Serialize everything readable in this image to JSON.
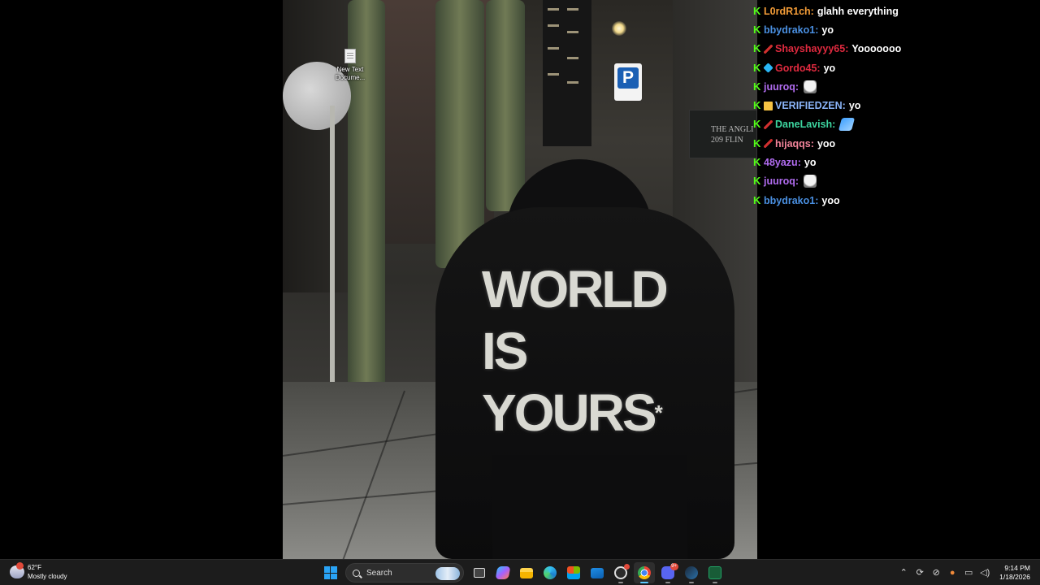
{
  "desktop": {
    "icon_label": "New Text Docume..."
  },
  "wallpaper": {
    "hoodie_line1": "WORLD",
    "hoodie_line2": "IS",
    "hoodie_line3": "YOURS",
    "hoodie_mark": "*",
    "parking_sign": "P",
    "plaque_text": "THE ANGLI\n209 FLIN"
  },
  "chat": {
    "messages": [
      {
        "user": "L0rdR1ch",
        "user_color": "#f39c37",
        "extra_badge": "",
        "text": "glahh everything",
        "emote": ""
      },
      {
        "user": "bbydrako1",
        "user_color": "#4a90e2",
        "extra_badge": "",
        "text": "yo",
        "emote": ""
      },
      {
        "user": "Shayshayyy65",
        "user_color": "#e02a3f",
        "extra_badge": "red",
        "text": "Yooooooo",
        "emote": ""
      },
      {
        "user": "Gordo45",
        "user_color": "#e02a3f",
        "extra_badge": "cube",
        "text": "yo",
        "emote": ""
      },
      {
        "user": "juuroq",
        "user_color": "#b16cf0",
        "extra_badge": "",
        "text": "",
        "emote": "ghost"
      },
      {
        "user": "VERIFIEDZEN",
        "user_color": "#8ab4f8",
        "extra_badge": "crown",
        "text": "yo",
        "emote": ""
      },
      {
        "user": "DaneLavish",
        "user_color": "#3dd6a0",
        "extra_badge": "red",
        "text": "",
        "emote": "blue"
      },
      {
        "user": "hijaqqs",
        "user_color": "#f2849a",
        "extra_badge": "red",
        "text": "yoo",
        "emote": ""
      },
      {
        "user": "48yazu",
        "user_color": "#b16cf0",
        "extra_badge": "",
        "text": "yo",
        "emote": ""
      },
      {
        "user": "juuroq",
        "user_color": "#b16cf0",
        "extra_badge": "",
        "text": "",
        "emote": "ghost"
      },
      {
        "user": "bbydrako1",
        "user_color": "#4a90e2",
        "extra_badge": "",
        "text": "yoo",
        "emote": ""
      }
    ]
  },
  "taskbar": {
    "weather_temp": "62°F",
    "weather_desc": "Mostly cloudy",
    "search_label": "Search",
    "time": "9:14 PM",
    "date": "1/18/2026",
    "discord_badge": "9+",
    "pinned_icons": [
      "windows-start-icon",
      "search",
      "task-view-icon",
      "copilot-icon",
      "file-explorer-icon",
      "edge-icon",
      "store-icon",
      "mail-icon",
      "obs-icon",
      "chrome-icon",
      "discord-icon",
      "steam-icon",
      "excel-icon"
    ]
  },
  "colors": {
    "kick_green": "#53fc18",
    "accent_blue": "#5cc8ff",
    "taskbar_bg": "#1c1c1c"
  }
}
